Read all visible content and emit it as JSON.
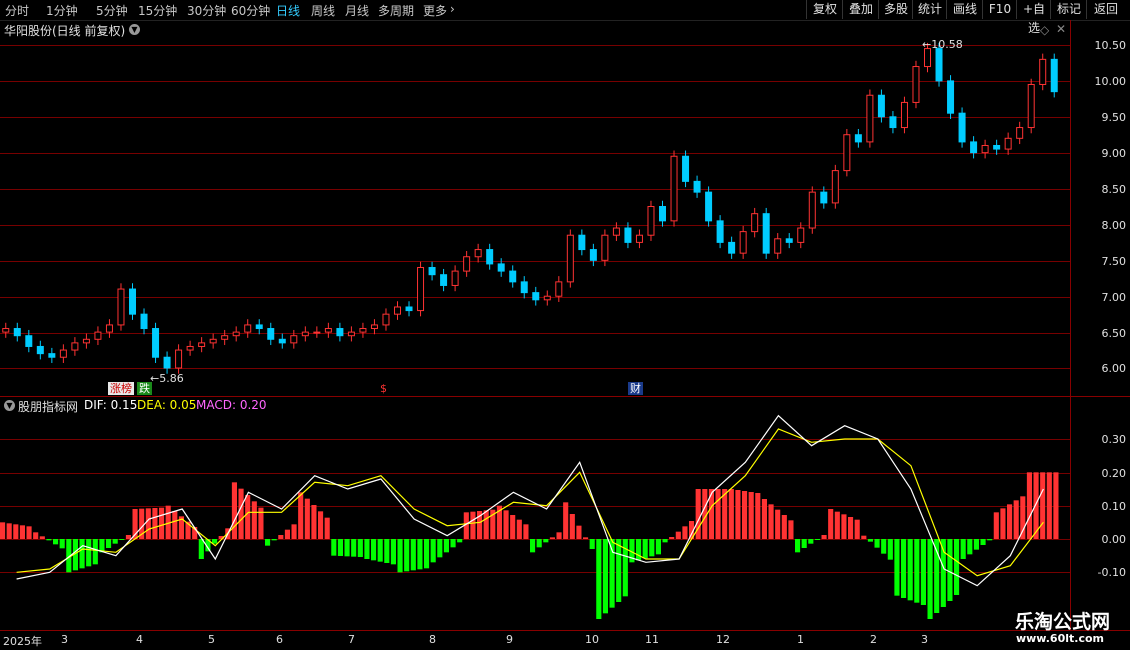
{
  "toolbar": {
    "periods": [
      "分时",
      "1分钟",
      "5分钟",
      "15分钟",
      "30分钟",
      "60分钟",
      "日线",
      "周线",
      "月线",
      "多周期",
      "更多"
    ],
    "tools": [
      "复权",
      "叠加",
      "多股",
      "统计",
      "画线",
      "F10",
      "+自选",
      "标记",
      "返回"
    ]
  },
  "main_panel": {
    "title": "华阳股份(日线 前复权)",
    "price_labels": [
      "10.50",
      "10.00",
      "9.50",
      "9.00",
      "8.50",
      "8.00",
      "7.50",
      "7.00",
      "6.50",
      "6.00"
    ],
    "high_marker": "10.58",
    "low_marker": "5.86",
    "events": [
      "涨榜",
      "跌",
      "$",
      "财"
    ]
  },
  "indicator_panel": {
    "name": "股朋指标网",
    "dif_label": "DIF: 0.15",
    "dea_label": "DEA: 0.05",
    "macd_label": "MACD: 0.20",
    "scale_labels": [
      "0.30",
      "0.20",
      "0.10",
      "0.00",
      "-0.10"
    ]
  },
  "time_axis": [
    "2025年",
    "3",
    "4",
    "5",
    "6",
    "7",
    "8",
    "9",
    "10",
    "11",
    "12",
    "1",
    "2",
    "3"
  ],
  "watermark": {
    "name": "乐淘公式网",
    "url": "www.60lt.com"
  },
  "colors": {
    "up": "#ff3333",
    "down": "#00ff00",
    "dif": "#ffffff",
    "dea": "#ffff00",
    "macd": "#ff66ff",
    "active": "#33ccff"
  },
  "chart_data": [
    {
      "type": "candlestick",
      "title": "华阳股份(日线 前复权)",
      "ylim": [
        5.8,
        10.7
      ],
      "close": [
        6.55,
        6.45,
        6.3,
        6.2,
        6.15,
        6.25,
        6.35,
        6.4,
        6.5,
        6.6,
        7.1,
        6.75,
        6.55,
        6.15,
        6.0,
        6.25,
        6.3,
        6.35,
        6.4,
        6.45,
        6.5,
        6.6,
        6.55,
        6.4,
        6.35,
        6.45,
        6.5,
        6.5,
        6.55,
        6.45,
        6.5,
        6.55,
        6.6,
        6.75,
        6.85,
        6.8,
        7.4,
        7.3,
        7.15,
        7.35,
        7.55,
        7.65,
        7.45,
        7.35,
        7.2,
        7.05,
        6.95,
        7.0,
        7.2,
        7.85,
        7.65,
        7.5,
        7.85,
        7.95,
        7.75,
        7.85,
        8.25,
        8.05,
        8.95,
        8.6,
        8.45,
        8.05,
        7.75,
        7.6,
        7.9,
        8.15,
        7.6,
        7.8,
        7.75,
        7.95,
        8.45,
        8.3,
        8.75,
        9.25,
        9.15,
        9.8,
        9.5,
        9.35,
        9.7,
        10.2,
        10.45,
        10.0,
        9.55,
        9.15,
        9.0,
        9.1,
        9.05,
        9.2,
        9.35,
        9.95,
        10.3,
        9.85
      ]
    },
    {
      "type": "bar+line",
      "name": "股朋指标网",
      "ylim": [
        -0.25,
        0.42
      ],
      "series": [
        {
          "name": "DIF",
          "values": [
            -0.12,
            -0.1,
            -0.02,
            -0.05,
            0.06,
            0.09,
            -0.06,
            0.14,
            0.09,
            0.19,
            0.15,
            0.18,
            0.06,
            0.01,
            0.07,
            0.14,
            0.09,
            0.23,
            -0.04,
            -0.07,
            -0.06,
            0.14,
            0.23,
            0.37,
            0.28,
            0.34,
            0.3,
            0.15,
            -0.09,
            -0.14,
            -0.05,
            0.15
          ]
        },
        {
          "name": "DEA",
          "values": [
            -0.1,
            -0.09,
            -0.03,
            -0.04,
            0.03,
            0.06,
            -0.02,
            0.08,
            0.08,
            0.17,
            0.16,
            0.19,
            0.09,
            0.04,
            0.05,
            0.11,
            0.1,
            0.2,
            -0.01,
            -0.06,
            -0.06,
            0.1,
            0.19,
            0.33,
            0.29,
            0.3,
            0.3,
            0.22,
            -0.04,
            -0.11,
            -0.08,
            0.05
          ]
        },
        {
          "name": "MACD",
          "values": [
            0.05,
            0.02,
            -0.1,
            -0.04,
            0.09,
            0.1,
            -0.06,
            0.17,
            -0.02,
            0.14,
            -0.05,
            -0.06,
            -0.1,
            -0.07,
            0.08,
            0.1,
            -0.04,
            0.11,
            -0.24,
            -0.07,
            -0.01,
            0.15,
            0.15,
            0.12,
            -0.04,
            0.09,
            0.01,
            -0.17,
            -0.24,
            -0.06,
            0.08,
            0.2
          ]
        }
      ]
    }
  ]
}
